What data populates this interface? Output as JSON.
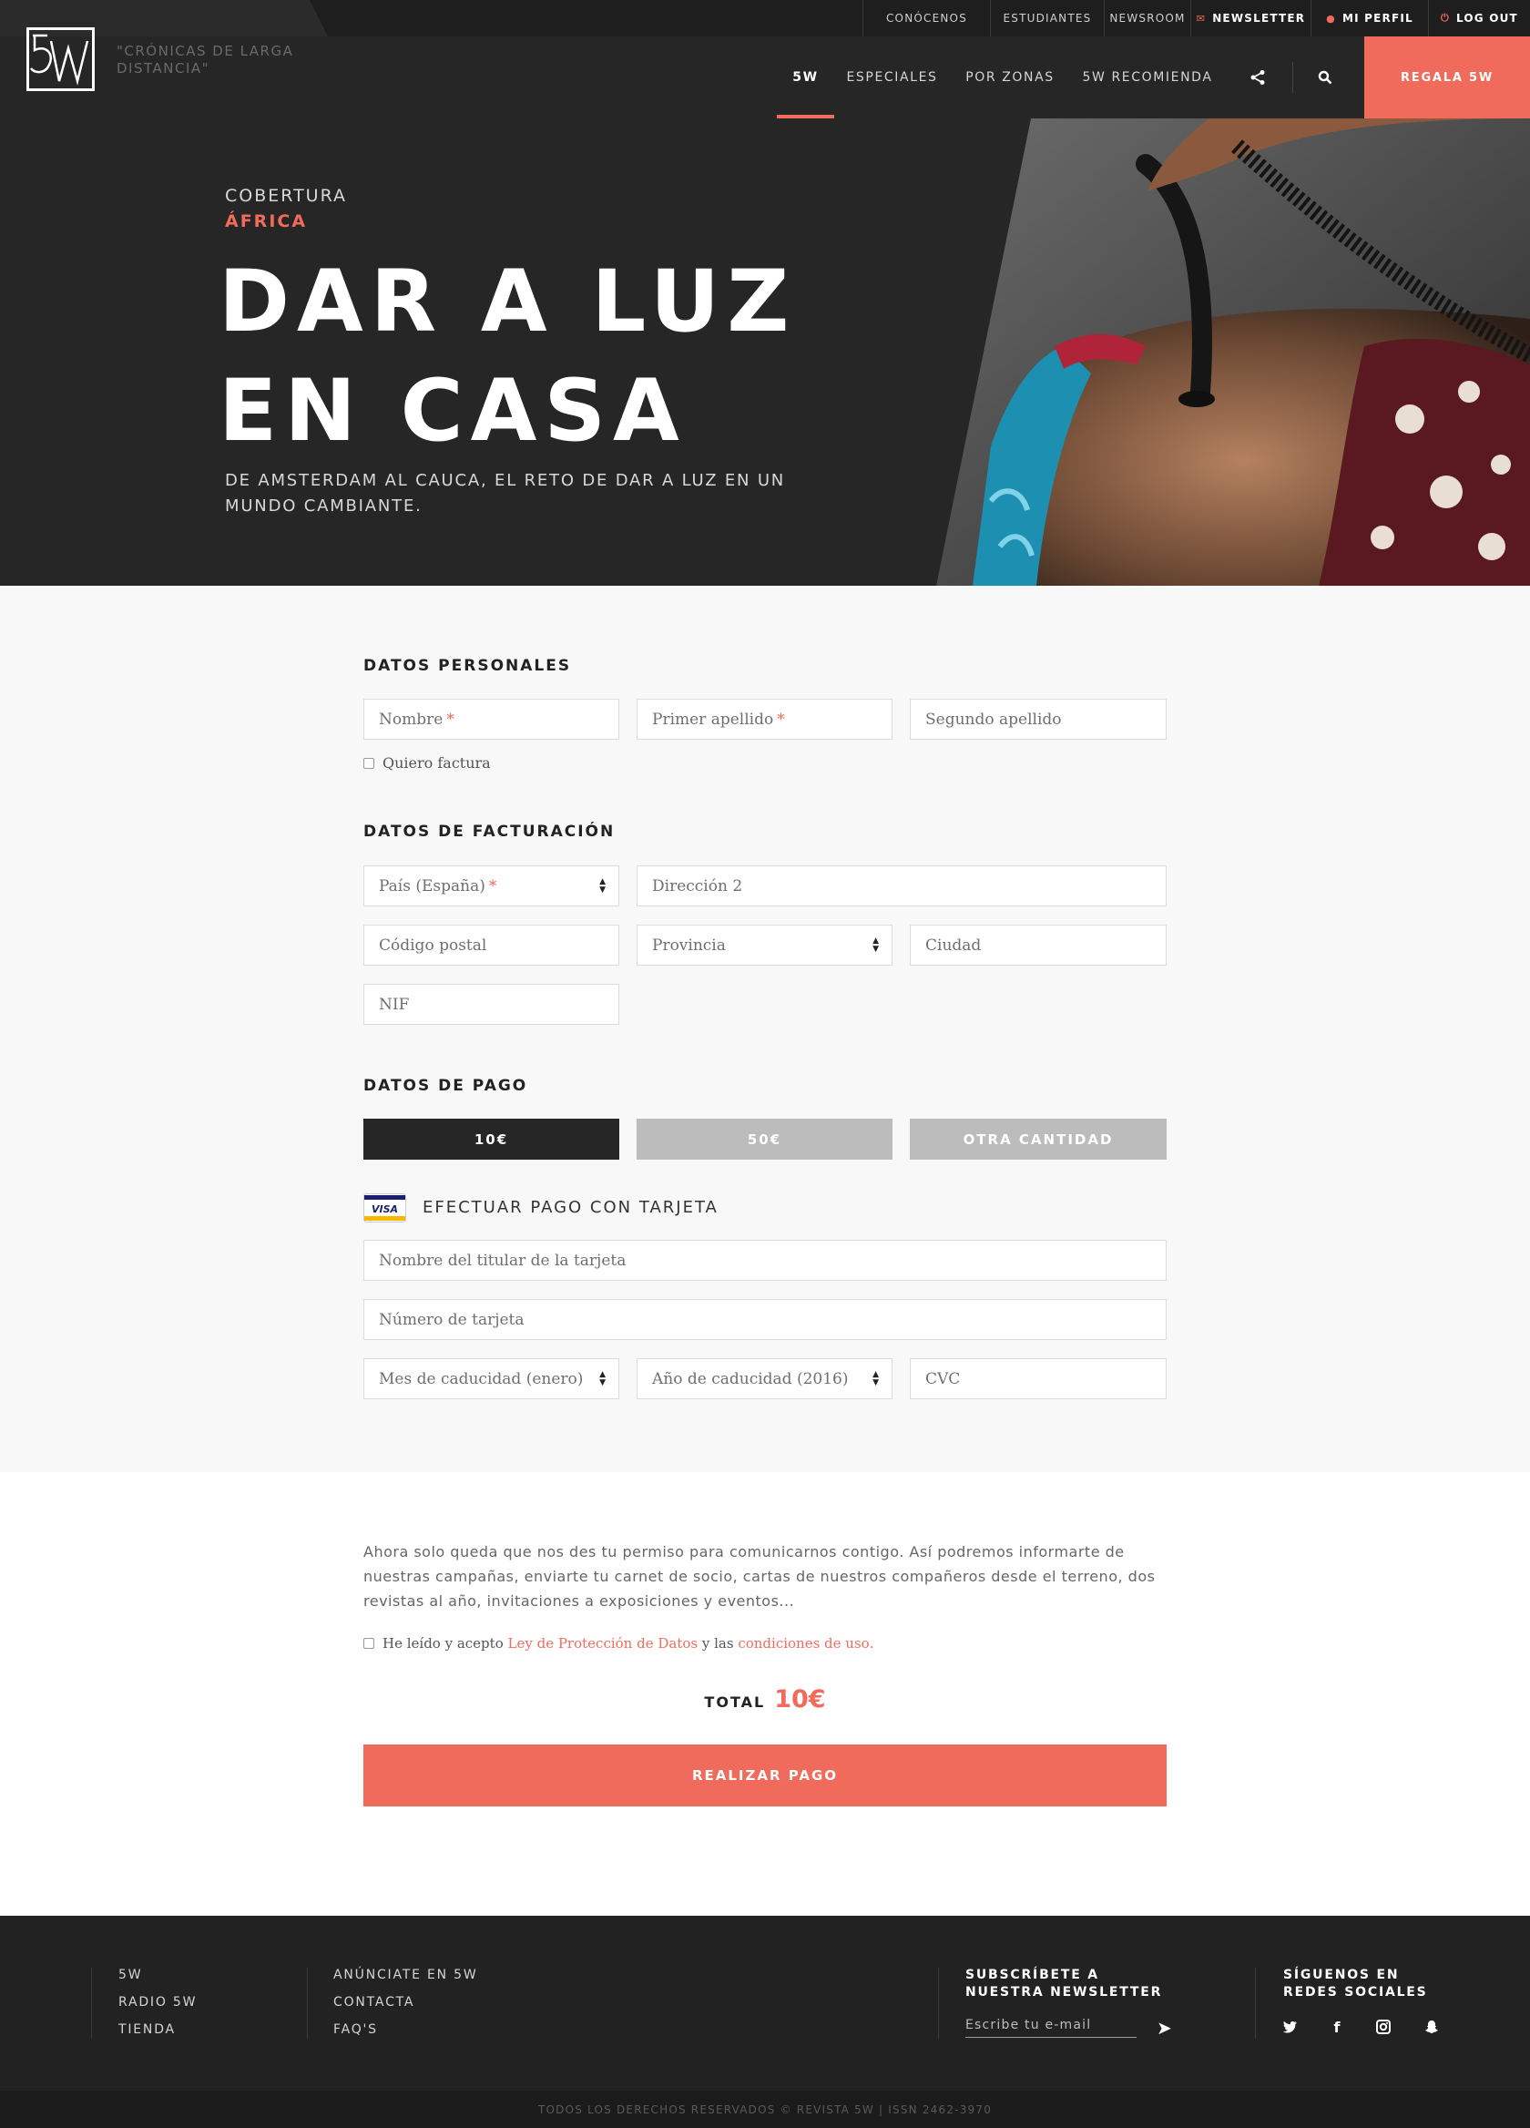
{
  "topbar": {
    "links": [
      "CONÓCENOS",
      "ESTUDIANTES",
      "NEWSROOM"
    ],
    "newsletter": "NEWSLETTER",
    "profile": "MI PERFIL",
    "logout": "LOG OUT"
  },
  "brand": {
    "logo": "5W",
    "tagline": "\"CRÓNICAS DE LARGA DISTANCIA\""
  },
  "nav": {
    "items": [
      "5W",
      "ESPECIALES",
      "POR ZONAS",
      "5W  RECOMIENDA"
    ],
    "cta": "REGALA 5W"
  },
  "hero": {
    "kicker": "COBERTURA",
    "category": "ÁFRICA",
    "title_line1": "DAR A LUZ",
    "title_line2": "EN CASA",
    "subtitle": "DE AMSTERDAM AL CAUCA, EL RETO DE DAR A LUZ EN UN MUNDO CAMBIANTE."
  },
  "personal": {
    "title": "DATOS PERSONALES",
    "nombre": "Nombre",
    "apellido1": "Primer apellido",
    "apellido2": "Segundo apellido",
    "factura": "Quiero factura",
    "required_mark": "*"
  },
  "billing": {
    "title": "DATOS DE FACTURACIÓN",
    "pais": "País (España)",
    "direccion": "Dirección 2",
    "cp": "Código postal",
    "provincia": "Provincia",
    "ciudad": "Ciudad",
    "nif": "NIF"
  },
  "payment": {
    "title": "DATOS DE PAGO",
    "amounts": [
      "10€",
      "50€",
      "OTRA CANTIDAD"
    ],
    "selected_amount": "10€",
    "card_brand": "VISA",
    "card_title": "EFECTUAR PAGO CON TARJETA",
    "holder": "Nombre del titular de la tarjeta",
    "number": "Número de tarjeta",
    "month": "Mes de caducidad (enero)",
    "year": "Año de caducidad (2016)",
    "cvc": "CVC"
  },
  "consent": {
    "text": "Ahora solo queda que nos des tu permiso para comunicarnos contigo. Así podremos informarte de nuestras campañas, enviarte tu carnet de socio, cartas de nuestros compañeros desde el terreno, dos revistas al año, invitaciones a exposiciones y eventos...",
    "accept_prefix": "He leído y acepto",
    "link1": "Ley de Protección de Datos",
    "middle": "y las",
    "link2": "condiciones de uso",
    "end": "."
  },
  "total": {
    "label": "TOTAL",
    "value": "10€"
  },
  "submit": "REALIZAR PAGO",
  "footer": {
    "col1": [
      "5W",
      "RADIO 5W",
      "TIENDA"
    ],
    "col2": [
      "ANÚNCIATE EN 5W",
      "CONTACTA",
      "FAQ'S"
    ],
    "newsletter_title_1": "SUBSCRÍBETE A",
    "newsletter_title_2": "NUESTRA NEWSLETTER",
    "email_placeholder": "Escribe tu e-mail",
    "social_title_1": "SÍGUENOS EN",
    "social_title_2": "REDES SOCIALES",
    "copyright": "TODOS LOS DERECHOS RESERVADOS © REVISTA 5W | ISSN 2462-3970"
  },
  "colors": {
    "accent": "#f06b5b",
    "dark": "#262626",
    "inactive_amount": "#bcbcbc",
    "selected_amount": "#262626"
  },
  "icons": {
    "newsletter": "mail-icon",
    "profile": "user-icon",
    "logout": "power-icon",
    "share": "share-icon",
    "search": "search-icon",
    "select": "select-arrows-icon",
    "send": "send-arrow-icon",
    "social": [
      "twitter-icon",
      "facebook-icon",
      "instagram-icon",
      "snapchat-icon"
    ]
  }
}
